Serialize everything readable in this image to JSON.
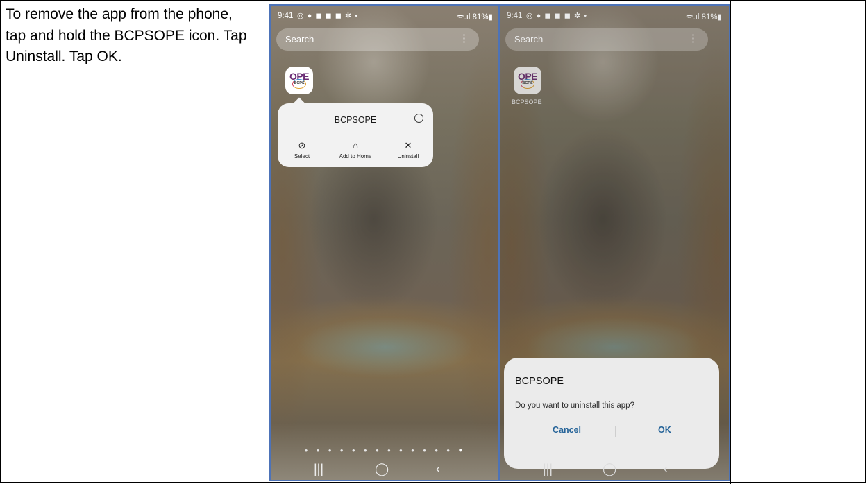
{
  "instruction": {
    "text": "To remove the app from the phone, tap and hold the BCPSOPE icon.  Tap Uninstall.  Tap OK."
  },
  "phone": {
    "status_time": "9:41",
    "status_icons": "◎ ● ◼ ◼ ◼ ✲ •",
    "status_right": "ᯤ.ıl 81%▮",
    "search_placeholder": "Search",
    "search_menu": "⋮",
    "app_icon_ope": "OPE",
    "app_icon_bcps": "BCPS",
    "app_label": "BCPSOPE",
    "page_dots": "● ● ● ● ● ● ● ● ● ● ● ● ●",
    "page_dot_active": "●",
    "nav": {
      "recents": "|||",
      "home": "◯",
      "back": "‹"
    }
  },
  "popup": {
    "title": "BCPSOPE",
    "info": "i",
    "actions": [
      {
        "icon": "⊘",
        "label": "Select"
      },
      {
        "icon": "⌂",
        "label": "Add to Home"
      },
      {
        "icon": "✕",
        "label": "Uninstall"
      }
    ]
  },
  "dialog": {
    "title": "BCPSOPE",
    "message": "Do you want to uninstall this app?",
    "cancel": "Cancel",
    "ok": "OK"
  }
}
